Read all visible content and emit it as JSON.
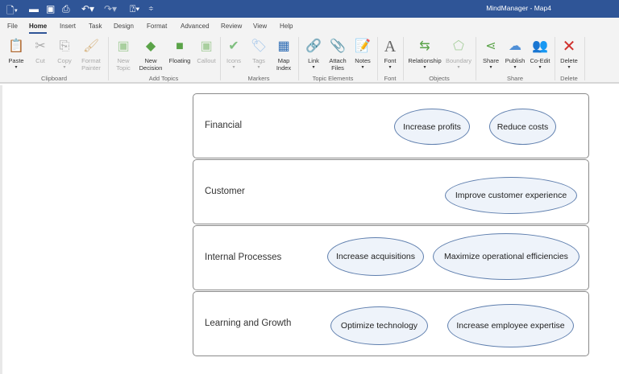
{
  "titlebar": {
    "title": "MindManager - Map4",
    "quick_access": [
      "new-icon",
      "open-icon",
      "save-icon",
      "print-icon",
      "undo-icon",
      "redo-icon",
      "help-icon",
      "customize-icon"
    ]
  },
  "tabs": [
    "File",
    "Home",
    "Insert",
    "Task",
    "Design",
    "Format",
    "Advanced",
    "Review",
    "View",
    "Help"
  ],
  "active_tab": "Home",
  "ribbon": {
    "buttons": [
      {
        "label": "Paste",
        "icon": "paste-icon"
      },
      {
        "label": "Cut",
        "icon": "cut-icon"
      },
      {
        "label": "Copy",
        "icon": "copy-icon"
      },
      {
        "label": "Format Painter",
        "icon": "format-painter-icon"
      },
      {
        "label": "New Topic",
        "icon": "new-topic-icon"
      },
      {
        "label": "New Decision",
        "icon": "new-decision-icon"
      },
      {
        "label": "Floating",
        "icon": "floating-icon"
      },
      {
        "label": "Callout",
        "icon": "callout-icon"
      },
      {
        "label": "Icons",
        "icon": "icons-icon"
      },
      {
        "label": "Tags",
        "icon": "tags-icon"
      },
      {
        "label": "Map Index",
        "icon": "map-index-icon"
      },
      {
        "label": "Link",
        "icon": "link-icon"
      },
      {
        "label": "Attach Files",
        "icon": "attach-icon"
      },
      {
        "label": "Notes",
        "icon": "notes-icon"
      },
      {
        "label": "Font",
        "icon": "font-icon"
      },
      {
        "label": "Relationship",
        "icon": "relationship-icon"
      },
      {
        "label": "Boundary",
        "icon": "boundary-icon"
      },
      {
        "label": "Share",
        "icon": "share-icon"
      },
      {
        "label": "Publish",
        "icon": "publish-icon"
      },
      {
        "label": "Co-Edit",
        "icon": "co-edit-icon"
      },
      {
        "label": "Delete",
        "icon": "delete-icon"
      }
    ],
    "groups": [
      "Clipboard",
      "Add Topics",
      "Markers",
      "Topic Elements",
      "Font",
      "Objects",
      "Share",
      "Delete"
    ]
  },
  "map": {
    "rows": [
      {
        "label": "Financial",
        "topics": [
          "Increase profits",
          "Reduce costs"
        ]
      },
      {
        "label": "Customer",
        "topics": [
          "Improve customer experience"
        ]
      },
      {
        "label": "Internal Processes",
        "topics": [
          "Increase acquisitions",
          "Maximize operational efficiencies"
        ]
      },
      {
        "label": "Learning and Growth",
        "topics": [
          "Optimize technology",
          "Increase employee expertise"
        ]
      }
    ]
  },
  "colors": {
    "titlebar": "#2f5597",
    "ellipse_border": "#5f7fae",
    "ellipse_fill": "#eef3fa",
    "delete": "#d0312d",
    "green": "#5aa348"
  }
}
